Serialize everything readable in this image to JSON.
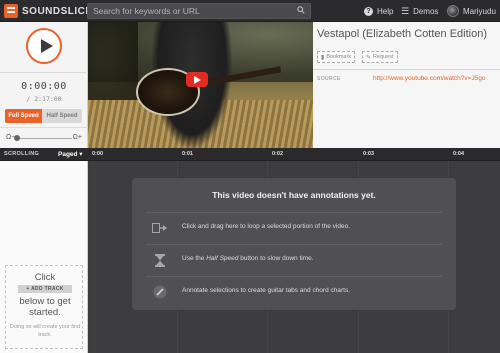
{
  "header": {
    "logo_text": "SOUNDSLICE",
    "search_placeholder": "Search for keywords or URL",
    "help_label": "Help",
    "demos_label": "Demos",
    "user_name": "Mariyudu"
  },
  "player": {
    "current_time": "0:00:00",
    "total_time": "/ 2:17:00",
    "full_speed_label": "Full Speed",
    "half_speed_label": "Half Speed",
    "zoom_minus": "Ω−",
    "zoom_plus": "Ω+"
  },
  "video_info": {
    "title": "Vestapol (Elizabeth Cotten Edition)",
    "bookmark_label": "Bookmark",
    "request_label": "Request",
    "source_label": "SOURCE",
    "source_url": "http://www.youtube.com/watch?v=J5go"
  },
  "timeline": {
    "scrolling_label": "SCROLLING",
    "paged_label": "Paged ▾",
    "ticks": [
      "0:00",
      "0:01",
      "0:02",
      "0:03",
      "0:04"
    ]
  },
  "tracks": {
    "click_text": "Click",
    "add_track_label": "+ ADD TRACK",
    "below_text": "below to get started.",
    "hint_text": "Doing so will create your first track."
  },
  "annotations": {
    "title": "This video doesn't have annotations yet.",
    "tip1": "Click and drag here to loop a selected portion of the video.",
    "tip2_pre": "Use the ",
    "tip2_em": "Half Speed",
    "tip2_post": " button to slow down time.",
    "tip3": "Annotate selections to create guitar tabs and chord charts."
  },
  "colors": {
    "accent": "#e8622a",
    "topbar": "#2b2b2d",
    "youtube_red": "#e32b21"
  }
}
